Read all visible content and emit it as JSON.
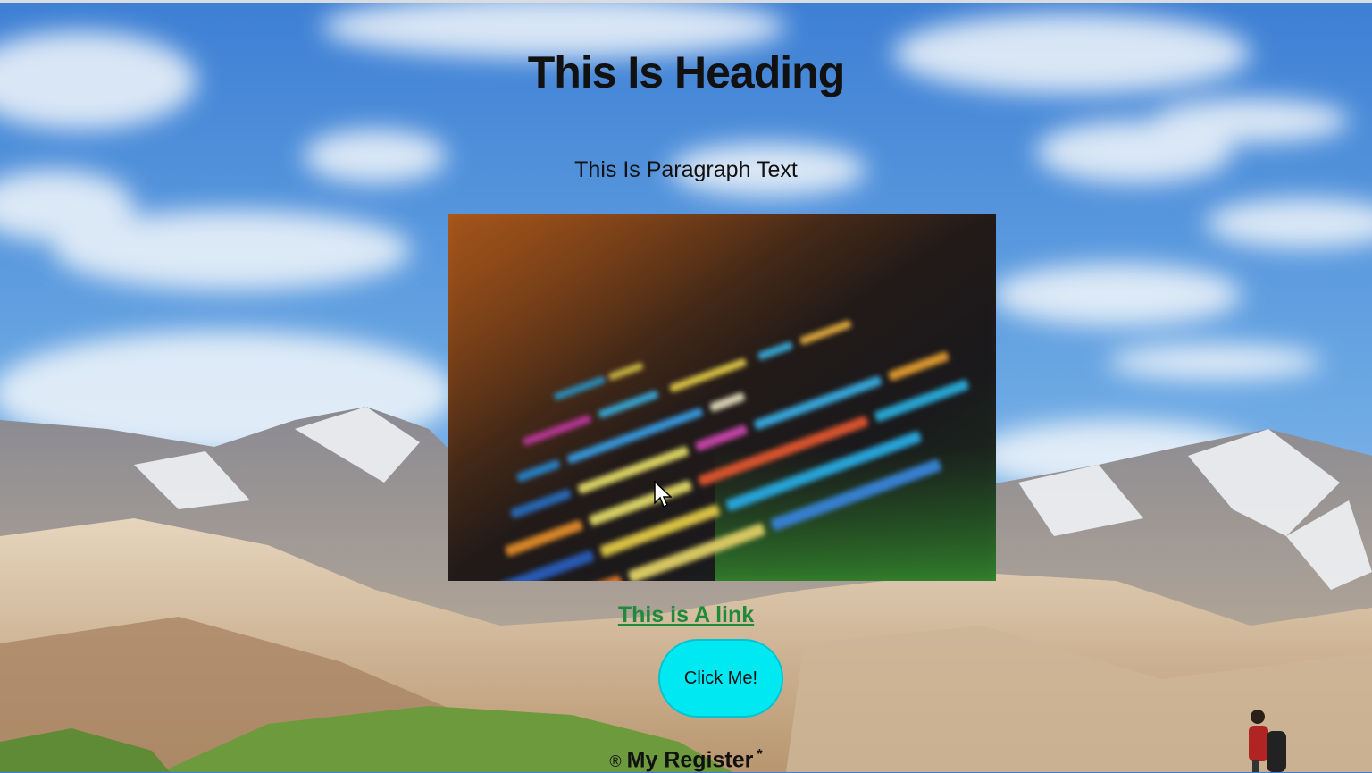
{
  "heading": "This Is Heading",
  "paragraph": "This Is Paragraph Text",
  "image": {
    "alt": "code screenshot"
  },
  "link": {
    "label": "This is A link"
  },
  "button": {
    "label": "Click Me!"
  },
  "footer": {
    "symbol": "®",
    "text": "My Register",
    "mark": "*"
  },
  "colors": {
    "link": "#1f8a3a",
    "button": "#00e8f2",
    "sky": "#3f7fd0"
  }
}
